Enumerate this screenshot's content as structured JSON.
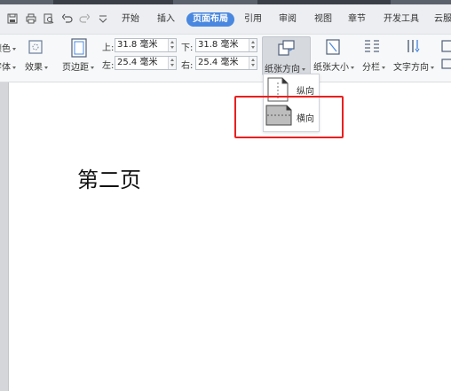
{
  "menubar": {
    "tabs": [
      {
        "label": "开始",
        "active": false
      },
      {
        "label": "插入",
        "active": false
      },
      {
        "label": "页面布局",
        "active": true
      },
      {
        "label": "引用",
        "active": false
      },
      {
        "label": "审阅",
        "active": false
      },
      {
        "label": "视图",
        "active": false
      },
      {
        "label": "章节",
        "active": false
      },
      {
        "label": "开发工具",
        "active": false
      },
      {
        "label": "云服",
        "active": false
      }
    ]
  },
  "ribbon": {
    "color_partial": "颜色",
    "font_partial": "字体",
    "effects": "效果",
    "margins": "页边距",
    "margin_top_label": "上:",
    "margin_top_value": "31.8 毫米",
    "margin_bottom_label": "下:",
    "margin_bottom_value": "31.8 毫米",
    "margin_left_label": "左:",
    "margin_left_value": "25.4 毫米",
    "margin_right_label": "右:",
    "margin_right_value": "25.4 毫米",
    "orientation": "纸张方向",
    "paper_size": "纸张大小",
    "columns": "分栏",
    "text_direction": "文字方向"
  },
  "orientation_menu": {
    "portrait": "纵向",
    "landscape": "横向"
  },
  "document": {
    "text": "第二页"
  },
  "colors": {
    "accent": "#4a88e0",
    "highlight": "#e8201f"
  }
}
